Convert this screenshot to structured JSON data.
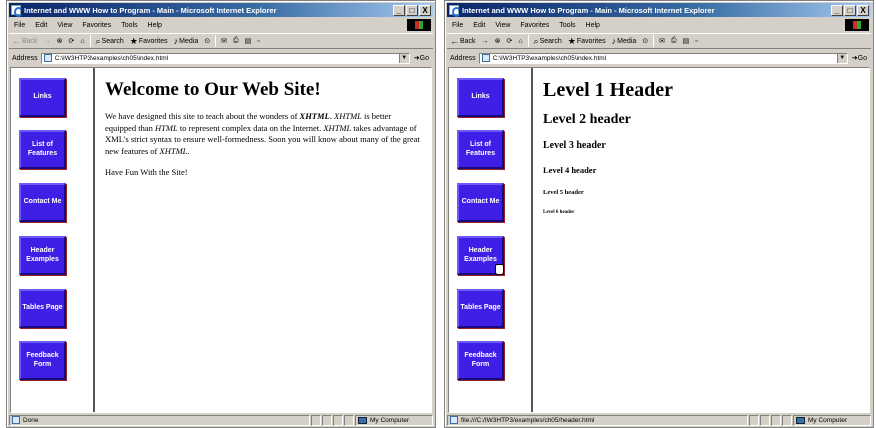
{
  "window_left": {
    "title": "Internet and WWW How to Program - Main - Microsoft Internet Explorer",
    "title_controls": [
      "_",
      "□",
      "X"
    ],
    "menu": [
      "File",
      "Edit",
      "View",
      "Favorites",
      "Tools",
      "Help"
    ],
    "toolbar": {
      "back": "Back",
      "forward": "→",
      "stop": "⊗",
      "refresh": "⟳",
      "home": "⌂",
      "search": "Search",
      "favorites": "Favorites",
      "media": "Media",
      "history": "⊙",
      "mail": "✉",
      "print": "⎙",
      "edit": "▤",
      "discuss": "▫"
    },
    "address_label": "Address",
    "address_value": "C:\\IW3HTP3\\examples\\ch05\\index.html",
    "go_label": "Go",
    "nav_buttons": [
      "Links",
      "List of Features",
      "Contact Me",
      "Header Examples",
      "Tables Page",
      "Feedback Form"
    ],
    "content": {
      "heading": "Welcome to Our Web Site!",
      "p1": [
        {
          "t": "We have designed this site to teach about the wonders of ",
          "s": "n"
        },
        {
          "t": "XHTML",
          "s": "bi"
        },
        {
          "t": ". ",
          "s": "n"
        },
        {
          "t": "XHTML",
          "s": "i"
        },
        {
          "t": " is better equipped than ",
          "s": "n"
        },
        {
          "t": "HTML",
          "s": "i"
        },
        {
          "t": " to represent complex data on the Internet. ",
          "s": "n"
        },
        {
          "t": "XHTML",
          "s": "i"
        },
        {
          "t": " takes advantage of XML's strict syntax to ensure well-formedness. Soon you will know about many of the great new features of ",
          "s": "n"
        },
        {
          "t": "XHTML",
          "s": "i"
        },
        {
          "t": ".",
          "s": "n"
        }
      ],
      "p2": "Have Fun With the Site!"
    },
    "status": "Done",
    "zone": "My Computer"
  },
  "window_right": {
    "title": "Internet and WWW How to Program - Main - Microsoft Internet Explorer",
    "title_controls": [
      "_",
      "□",
      "X"
    ],
    "menu": [
      "File",
      "Edit",
      "View",
      "Favorites",
      "Tools",
      "Help"
    ],
    "toolbar": {
      "back": "Back",
      "forward": "→",
      "stop": "⊗",
      "refresh": "⟳",
      "home": "⌂",
      "search": "Search",
      "favorites": "Favorites",
      "media": "Media",
      "history": "⊙",
      "mail": "✉",
      "print": "⎙",
      "edit": "▤",
      "discuss": "▫"
    },
    "address_label": "Address",
    "address_value": "C:\\IW3HTP3\\examples\\ch05\\index.html",
    "go_label": "Go",
    "nav_buttons": [
      "Links",
      "List of Features",
      "Contact Me",
      "Header Examples",
      "Tables Page",
      "Feedback Form"
    ],
    "headers": [
      "Level 1 Header",
      "Level 2 header",
      "Level 3 header",
      "Level 4 header",
      "Level 5 header",
      "Level 6 header"
    ],
    "status": "file:///C:/IW3HTP3/examples/ch05/header.html",
    "zone": "My Computer"
  },
  "colors": {
    "nav_button": "#3f1fe6",
    "title_gradient_start": "#0a246a",
    "chrome": "#d4d0c8"
  }
}
